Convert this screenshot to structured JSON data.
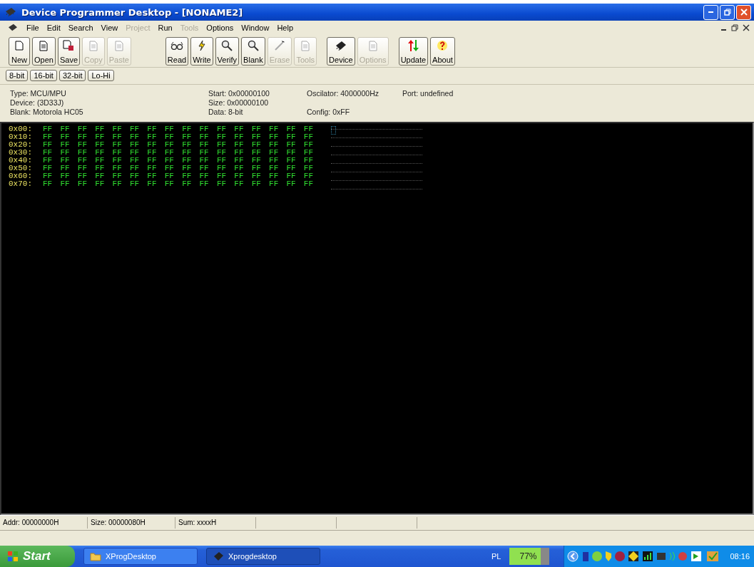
{
  "window": {
    "title": "Device Programmer Desktop - [NONAME2]"
  },
  "menu": [
    {
      "label": "File",
      "disabled": false
    },
    {
      "label": "Edit",
      "disabled": false
    },
    {
      "label": "Search",
      "disabled": false
    },
    {
      "label": "View",
      "disabled": false
    },
    {
      "label": "Project",
      "disabled": true
    },
    {
      "label": "Run",
      "disabled": false
    },
    {
      "label": "Tools",
      "disabled": true
    },
    {
      "label": "Options",
      "disabled": false
    },
    {
      "label": "Window",
      "disabled": false
    },
    {
      "label": "Help",
      "disabled": false
    }
  ],
  "toolbar": [
    [
      {
        "label": "New",
        "kind": "page",
        "disabled": false
      },
      {
        "label": "Open",
        "kind": "doc",
        "disabled": false
      },
      {
        "label": "Save",
        "kind": "save",
        "disabled": false
      },
      {
        "label": "Copy",
        "kind": "doc",
        "disabled": true
      },
      {
        "label": "Paste",
        "kind": "doc",
        "disabled": true
      }
    ],
    [
      {
        "label": "Read",
        "kind": "glasses",
        "disabled": false
      },
      {
        "label": "Write",
        "kind": "bolt",
        "disabled": false
      },
      {
        "label": "Verify",
        "kind": "magnifier",
        "disabled": false
      },
      {
        "label": "Blank",
        "kind": "magnifier",
        "disabled": false
      },
      {
        "label": "Erase",
        "kind": "wand",
        "disabled": true
      },
      {
        "label": "Tools",
        "kind": "doc",
        "disabled": true
      }
    ],
    [
      {
        "label": "Device",
        "kind": "chip",
        "disabled": false
      },
      {
        "label": "Options",
        "kind": "doc",
        "disabled": true
      }
    ],
    [
      {
        "label": "Update",
        "kind": "arrows",
        "disabled": false
      },
      {
        "label": "About",
        "kind": "question",
        "disabled": false
      }
    ]
  ],
  "view_buttons": [
    "8-bit",
    "16-bit",
    "32-bit",
    "Lo-Hi"
  ],
  "info": [
    [
      "Type: MCU/MPU",
      "Start: 0x00000100",
      "Oscilator: 4000000Hz",
      "Port: undefined"
    ],
    [
      "Device: (3D33J)",
      "Size: 0x00000100"
    ],
    [
      "Blank: Motorola HC05",
      "Data: 8-bit",
      "Config: 0xFF"
    ]
  ],
  "hex_rows": [
    {
      "address": "0x00:",
      "bytes": [
        "FF",
        "FF",
        "FF",
        "FF",
        "FF",
        "FF",
        "FF",
        "FF",
        "FF",
        "FF",
        "FF",
        "FF",
        "FF",
        "FF",
        "FF",
        "FF"
      ]
    },
    {
      "address": "0x10:",
      "bytes": [
        "FF",
        "FF",
        "FF",
        "FF",
        "FF",
        "FF",
        "FF",
        "FF",
        "FF",
        "FF",
        "FF",
        "FF",
        "FF",
        "FF",
        "FF",
        "FF"
      ]
    },
    {
      "address": "0x20:",
      "bytes": [
        "FF",
        "FF",
        "FF",
        "FF",
        "FF",
        "FF",
        "FF",
        "FF",
        "FF",
        "FF",
        "FF",
        "FF",
        "FF",
        "FF",
        "FF",
        "FF"
      ]
    },
    {
      "address": "0x30:",
      "bytes": [
        "FF",
        "FF",
        "FF",
        "FF",
        "FF",
        "FF",
        "FF",
        "FF",
        "FF",
        "FF",
        "FF",
        "FF",
        "FF",
        "FF",
        "FF",
        "FF"
      ]
    },
    {
      "address": "0x40:",
      "bytes": [
        "FF",
        "FF",
        "FF",
        "FF",
        "FF",
        "FF",
        "FF",
        "FF",
        "FF",
        "FF",
        "FF",
        "FF",
        "FF",
        "FF",
        "FF",
        "FF"
      ]
    },
    {
      "address": "0x50:",
      "bytes": [
        "FF",
        "FF",
        "FF",
        "FF",
        "FF",
        "FF",
        "FF",
        "FF",
        "FF",
        "FF",
        "FF",
        "FF",
        "FF",
        "FF",
        "FF",
        "FF"
      ]
    },
    {
      "address": "0x60:",
      "bytes": [
        "FF",
        "FF",
        "FF",
        "FF",
        "FF",
        "FF",
        "FF",
        "FF",
        "FF",
        "FF",
        "FF",
        "FF",
        "FF",
        "FF",
        "FF",
        "FF"
      ]
    },
    {
      "address": "0x70:",
      "bytes": [
        "FF",
        "FF",
        "FF",
        "FF",
        "FF",
        "FF",
        "FF",
        "FF",
        "FF",
        "FF",
        "FF",
        "FF",
        "FF",
        "FF",
        "FF",
        "FF"
      ]
    }
  ],
  "status_bar": [
    "Addr: 00000000H",
    "Size: 00000080H",
    "Sum: xxxxH"
  ],
  "taskbar": {
    "start": "Start",
    "tasks": [
      {
        "label": "XProgDesktop",
        "kind": "folder",
        "selected": false
      },
      {
        "label": "Xprogdesktop",
        "kind": "chip",
        "selected": true
      }
    ],
    "language": "PL",
    "battery": {
      "reading": "77%",
      "level": 0.77
    },
    "clock": "08:16"
  }
}
